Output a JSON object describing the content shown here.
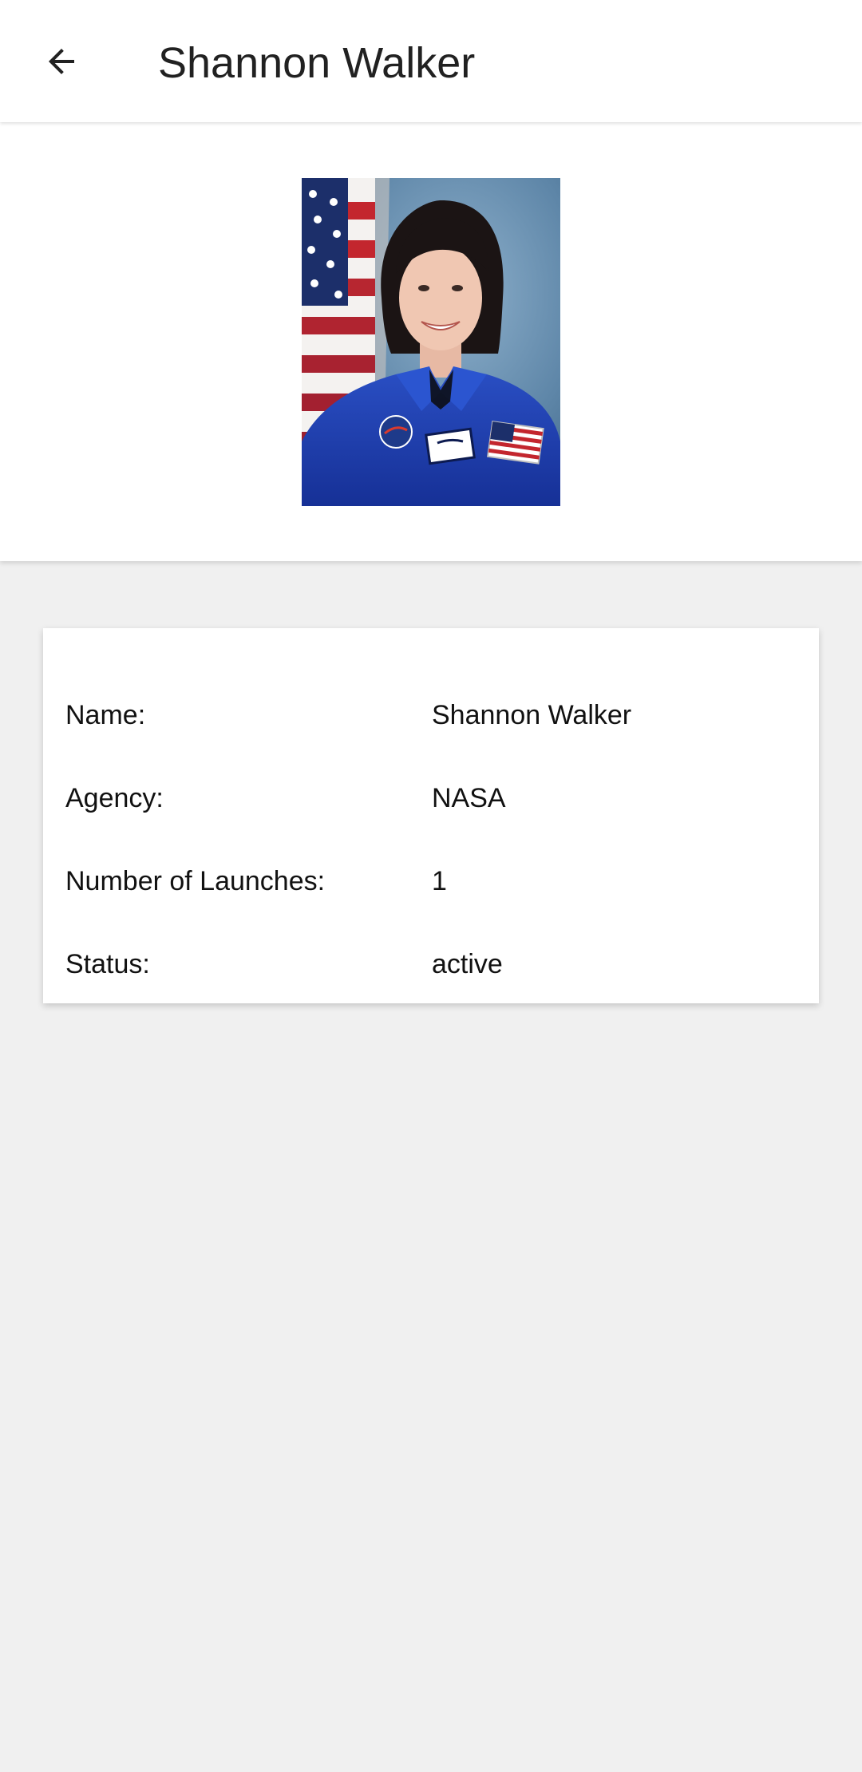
{
  "app_bar": {
    "title": "Shannon Walker",
    "back_icon": "arrow-back-icon"
  },
  "profile": {
    "photo_icon": "astronaut-portrait"
  },
  "details": {
    "rows": [
      {
        "label": "Name:",
        "value": "Shannon Walker"
      },
      {
        "label": "Agency:",
        "value": "NASA"
      },
      {
        "label": "Number of Launches:",
        "value": "1"
      },
      {
        "label": "Status:",
        "value": "active"
      }
    ]
  },
  "colors": {
    "background": "#f0f0f0",
    "surface": "#ffffff",
    "suit_blue": "#1f3fae",
    "photo_backdrop": "#5e86a8"
  }
}
